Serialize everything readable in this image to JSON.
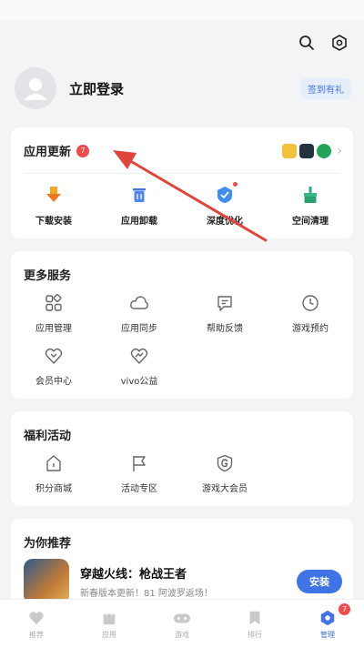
{
  "header": {
    "icons": [
      "search-icon",
      "settings-icon"
    ]
  },
  "profile": {
    "login_label": "立即登录",
    "signin_label": "签到有礼"
  },
  "updates": {
    "title": "应用更新",
    "badge": "7",
    "quick_actions": [
      {
        "label": "下载安装",
        "icon": "download-icon"
      },
      {
        "label": "应用卸载",
        "icon": "trash-icon"
      },
      {
        "label": "深度优化",
        "icon": "optimize-icon"
      },
      {
        "label": "空间清理",
        "icon": "broom-icon"
      }
    ]
  },
  "more_services": {
    "title": "更多服务",
    "items": [
      {
        "label": "应用管理",
        "icon": "apps-grid-icon"
      },
      {
        "label": "应用同步",
        "icon": "cloud-sync-icon"
      },
      {
        "label": "帮助反馈",
        "icon": "feedback-icon"
      },
      {
        "label": "游戏预约",
        "icon": "clock-icon"
      },
      {
        "label": "会员中心",
        "icon": "vip-heart-icon"
      },
      {
        "label": "vivo公益",
        "icon": "charity-heart-icon"
      }
    ]
  },
  "welfare": {
    "title": "福利活动",
    "items": [
      {
        "label": "积分商城",
        "icon": "house-icon"
      },
      {
        "label": "活动专区",
        "icon": "flag-icon"
      },
      {
        "label": "游戏大会员",
        "icon": "game-shield-icon"
      }
    ]
  },
  "recommend": {
    "title": "为你推荐",
    "game_name": "穿越火线：枪战王者",
    "game_desc": "新春版本更新！81 阿波罗返场！",
    "install_label": "安装"
  },
  "tabbar": {
    "tabs": [
      {
        "label": "推荐",
        "icon": "heart-icon"
      },
      {
        "label": "应用",
        "icon": "bag-icon"
      },
      {
        "label": "游戏",
        "icon": "gamepad-icon"
      },
      {
        "label": "排行",
        "icon": "bookmark-icon"
      },
      {
        "label": "管理",
        "icon": "manage-icon"
      }
    ],
    "manage_badge": "7"
  },
  "colors": {
    "accent": "#3f73e6",
    "badge": "#f04b4b",
    "annotation_arrow": "#e0453a"
  }
}
